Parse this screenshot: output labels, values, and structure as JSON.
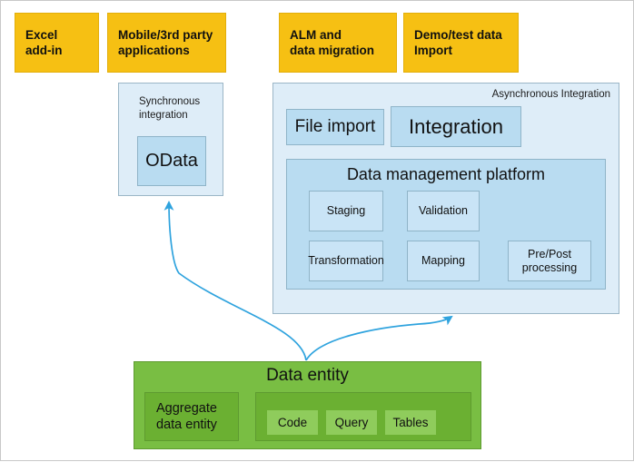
{
  "sources": [
    {
      "label": "Excel\nadd-in"
    },
    {
      "label": "Mobile/3rd party\napplications"
    },
    {
      "label": "ALM and\ndata migration"
    },
    {
      "label": "Demo/test data\nImport"
    }
  ],
  "sync": {
    "title": "Synchronous\nintegration",
    "odata_label": "OData"
  },
  "async": {
    "title": "Asynchronous Integration",
    "tiles": [
      {
        "label": "File import"
      },
      {
        "label": "Integration"
      }
    ],
    "dmp": {
      "title": "Data management platform",
      "tiles": [
        {
          "label": "Staging"
        },
        {
          "label": "Validation"
        },
        {
          "label": "Transformation"
        },
        {
          "label": "Mapping"
        },
        {
          "label": "Pre/Post\nprocessing"
        }
      ]
    }
  },
  "data_entity": {
    "title": "Data entity",
    "aggregate_label": "Aggregate\ndata entity",
    "tiles": [
      {
        "label": "Code"
      },
      {
        "label": "Query"
      },
      {
        "label": "Tables"
      }
    ]
  },
  "colors": {
    "source_fill": "#F6C013",
    "panel_fill": "#DEEDF8",
    "tile_fill": "#B9DCF1",
    "dmp_tile_fill": "#C9E4F6",
    "green_outer": "#79BE43",
    "green_mid": "#6BB032",
    "green_tile": "#8FCC5C",
    "arrow": "#2FA3DE"
  }
}
